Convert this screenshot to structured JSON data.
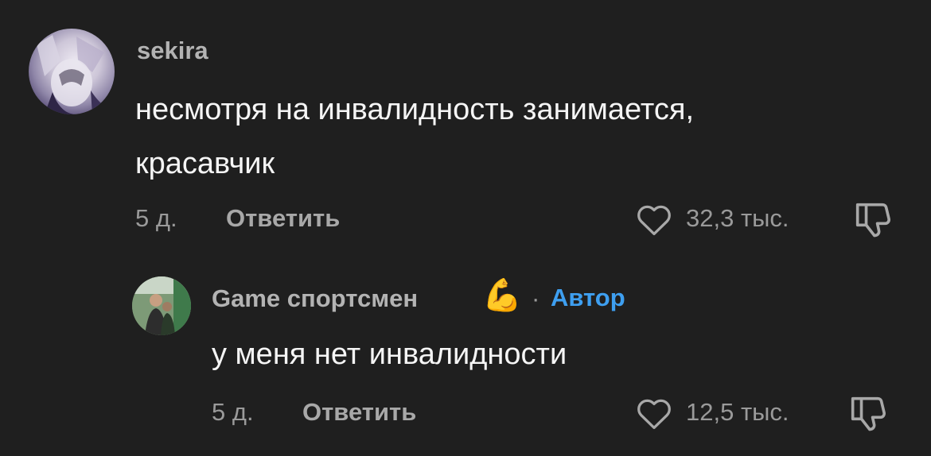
{
  "comments": [
    {
      "username": "sekira",
      "text_line1": "несмотря на инвалидность занимается,",
      "text_line2": "красавчик",
      "time": "5 д.",
      "reply_label": "Ответить",
      "likes": "32,3 тыс."
    }
  ],
  "reply": {
    "username": "Game спортсмен",
    "username_emoji": "💪",
    "separator": "·",
    "badge": "Автор",
    "text": "у меня нет инвалидности",
    "time": "5 д.",
    "reply_label": "Ответить",
    "likes": "12,5 тыс."
  },
  "colors": {
    "background": "#1f1f1f",
    "author_badge": "#3e9ff0"
  },
  "icons": [
    "heart-outline-icon",
    "thumbs-down-icon"
  ]
}
